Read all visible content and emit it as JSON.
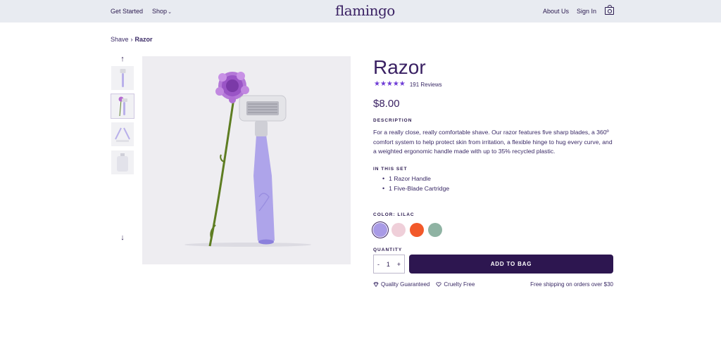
{
  "header": {
    "nav_left": {
      "get_started": "Get Started",
      "shop": "Shop"
    },
    "logo": "flamingo",
    "nav_right": {
      "about": "About Us",
      "sign_in": "Sign In"
    }
  },
  "breadcrumb": {
    "parent": "Shave",
    "separator": "›",
    "current": "Razor"
  },
  "gallery": {
    "up_arrow": "↑",
    "down_arrow": "↓",
    "thumbnail_count": 4
  },
  "product": {
    "title": "Razor",
    "stars": "★★★★★",
    "rating": 4.5,
    "reviews": "191 Reviews",
    "price": "$8.00",
    "description_label": "DESCRIPTION",
    "description": "For a really close, really comfortable shave. Our razor features five sharp blades, a 360º comfort system to help protect skin from irritation, a flexible hinge to hug every curve, and a weighted ergonomic handle made with up to 35% recycled plastic.",
    "in_set_label": "IN THIS SET",
    "in_set": [
      "1 Razor Handle",
      "1 Five-Blade Cartridge"
    ],
    "color_label": "COLOR: LILAC",
    "colors": [
      {
        "name": "lilac",
        "hex": "#a99be6",
        "selected": true
      },
      {
        "name": "pink",
        "hex": "#efcfd9",
        "selected": false
      },
      {
        "name": "orange",
        "hex": "#f2592a",
        "selected": false
      },
      {
        "name": "sage",
        "hex": "#8fb3a3",
        "selected": false
      }
    ],
    "quantity_label": "QUANTITY",
    "quantity": {
      "minus": "-",
      "value": "1",
      "plus": "+"
    },
    "add_to_bag": "ADD TO BAG",
    "badges": {
      "quality": "Quality Guaranteed",
      "cruelty_free": "Cruelty Free"
    },
    "shipping": "Free shipping on orders over $30"
  },
  "icons": {
    "cart": "shopping-bag-icon",
    "gem": "gem-icon",
    "heart": "heart-icon"
  },
  "colors": {
    "primary": "#2d1650",
    "accent_star": "#6e3bd6",
    "topbar_bg": "#e8ebf1"
  }
}
